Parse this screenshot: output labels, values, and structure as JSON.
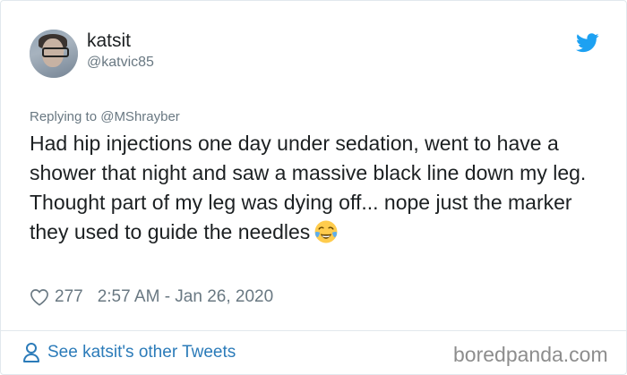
{
  "author": {
    "display_name": "katsit",
    "handle": "@katvic85"
  },
  "reply_context": "Replying to @MShrayber",
  "tweet": {
    "text": "Had hip injections one day under sedation, went to have a shower that night and saw a massive black line down my leg. Thought part of my leg was dying off... nope just the marker they used to guide the needles",
    "emoji": "face-with-tears-of-joy"
  },
  "stats": {
    "likes": "277",
    "timestamp": "2:57 AM - Jan 26, 2020"
  },
  "footer": {
    "link_label": "See katsit's other Tweets"
  },
  "watermark": "boredpanda.com",
  "colors": {
    "twitter_blue": "#1da1f2",
    "link_blue": "#2b7bb9",
    "muted_gray": "#697882",
    "text": "#1c2022",
    "border": "#e1e8ed"
  },
  "icons": {
    "brand": "twitter-bird-icon",
    "like": "heart-icon",
    "profile": "person-icon"
  }
}
